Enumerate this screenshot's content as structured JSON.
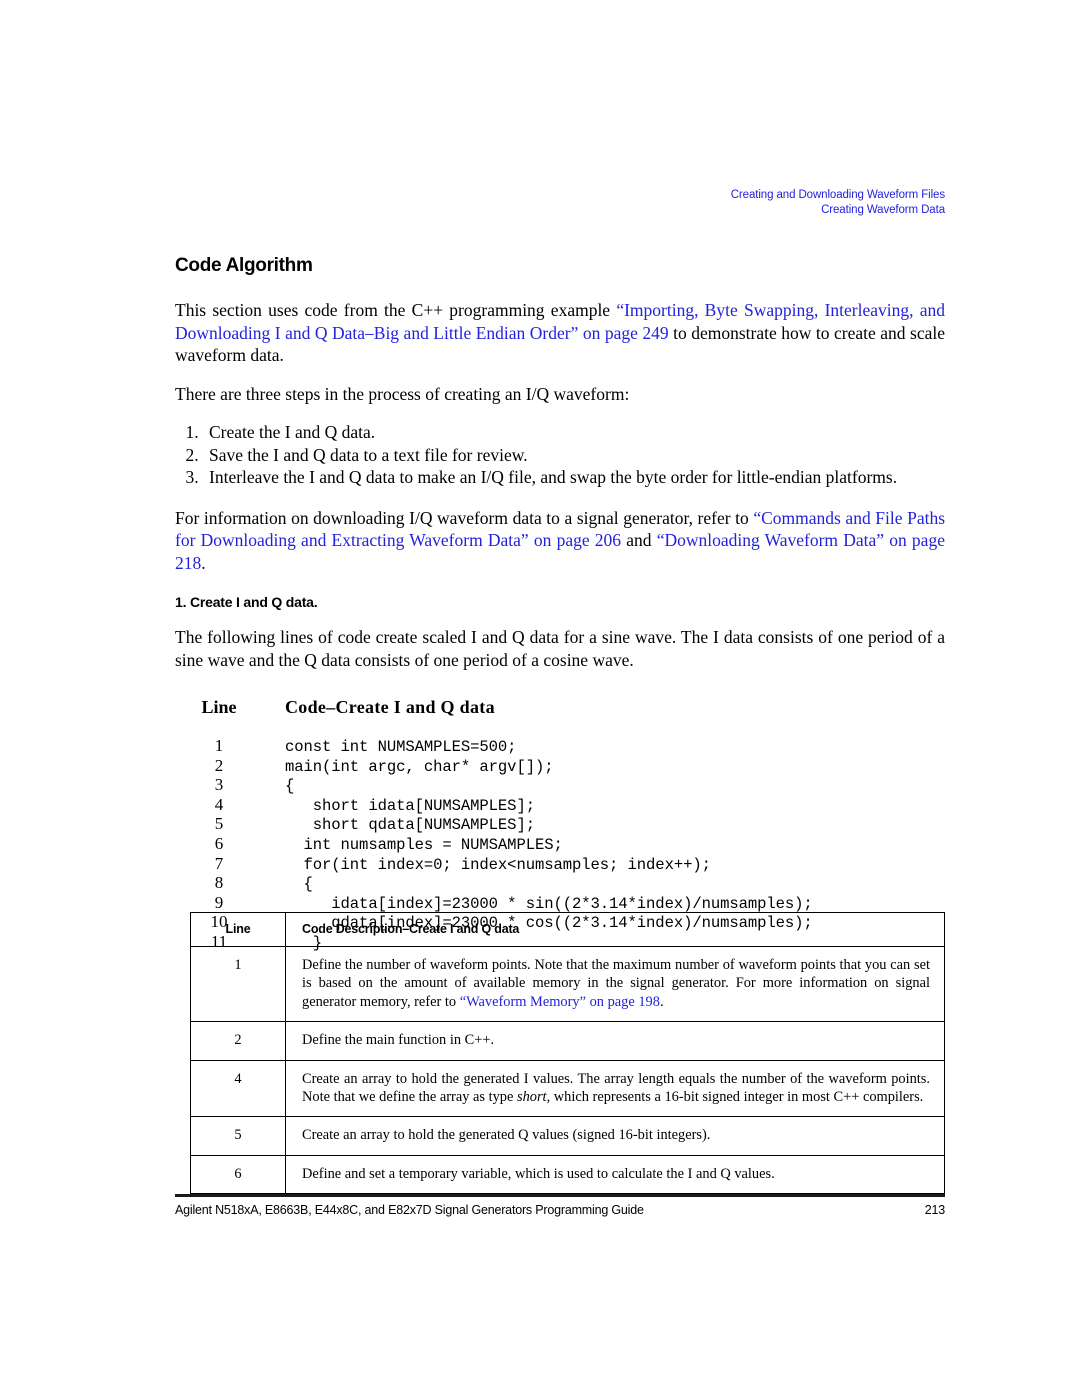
{
  "running_header": {
    "line1": "Creating and Downloading Waveform Files",
    "line2": "Creating Waveform Data",
    "color": "#2222dd"
  },
  "section": {
    "title": "Code Algorithm"
  },
  "intro": {
    "part1": "This section uses code from the C++ programming example ",
    "link1": "“Importing, Byte Swapping, Interleaving, and Downloading I and Q Data–Big and Little Endian Order” on page 249",
    "part2": " to demonstrate how to create and scale waveform data."
  },
  "steps_lead": "There are three steps in the process of creating an I/Q waveform:",
  "steps": [
    "Create the I and Q data.",
    "Save the I and Q data to a text file for review.",
    "Interleave the I and Q data to make an I/Q file, and swap the byte order for little-endian platforms."
  ],
  "download_para": {
    "part1": "For information on downloading I/Q waveform data to a signal generator, refer to ",
    "link1": "“Commands and File Paths for Downloading and Extracting Waveform Data” on page 206",
    "part2": " and ",
    "link2": "“Downloading Waveform Data” on page 218",
    "part3": "."
  },
  "subsection": {
    "title": "1. Create I and Q data.",
    "paragraph": "The following lines of code create scaled I and Q data for a sine wave. The I data consists of one period of a sine wave and the Q data consists of one period of a cosine wave."
  },
  "code_listing": {
    "header_line": "Line",
    "header_code": "Code–Create I and Q data",
    "rows": [
      {
        "num": "1",
        "src": "const int NUMSAMPLES=500;"
      },
      {
        "num": "2",
        "src": "main(int argc, char* argv[]);"
      },
      {
        "num": "3",
        "src": "{"
      },
      {
        "num": "4",
        "src": "   short idata[NUMSAMPLES];"
      },
      {
        "num": "5",
        "src": "   short qdata[NUMSAMPLES];"
      },
      {
        "num": "6",
        "src": "  int numsamples = NUMSAMPLES;"
      },
      {
        "num": "7",
        "src": "  for(int index=0; index<numsamples; index++);"
      },
      {
        "num": "8",
        "src": "  {"
      },
      {
        "num": "9",
        "src": "     idata[index]=23000 * sin((2*3.14*index)/numsamples);"
      },
      {
        "num": "10",
        "src": "     qdata[index]=23000 * cos((2*3.14*index)/numsamples);"
      },
      {
        "num": "11",
        "src": "   }"
      }
    ]
  },
  "desc_table": {
    "header_line": "Line",
    "header_desc": "Code Description–Create I and Q data",
    "rows": [
      {
        "num": "1",
        "text_before": "Define the number of waveform points. Note that the maximum number of waveform points that you can set is based on the amount of available memory in the signal generator. For more information on signal generator memory, refer to ",
        "link": "“Waveform Memory” on page 198",
        "text_after": "."
      },
      {
        "num": "2",
        "text_before": "Define the main function in C++.",
        "link": "",
        "text_after": ""
      },
      {
        "num": "4",
        "text_before": "Create an array to hold the generated I values. The array length equals the number of the waveform points. Note that we define the array as type ",
        "italic": "short",
        "text_after": ", which represents a 16-bit signed integer in most C++ compilers."
      },
      {
        "num": "5",
        "text_before": "Create an array to hold the generated Q values (signed 16-bit integers).",
        "link": "",
        "text_after": ""
      },
      {
        "num": "6",
        "text_before": "Define and set a temporary variable, which is used to calculate the I and Q values.",
        "link": "",
        "text_after": ""
      }
    ]
  },
  "footer": {
    "title": "Agilent N518xA, E8663B, E44x8C, and E82x7D Signal Generators Programming Guide",
    "page_number": "213"
  }
}
